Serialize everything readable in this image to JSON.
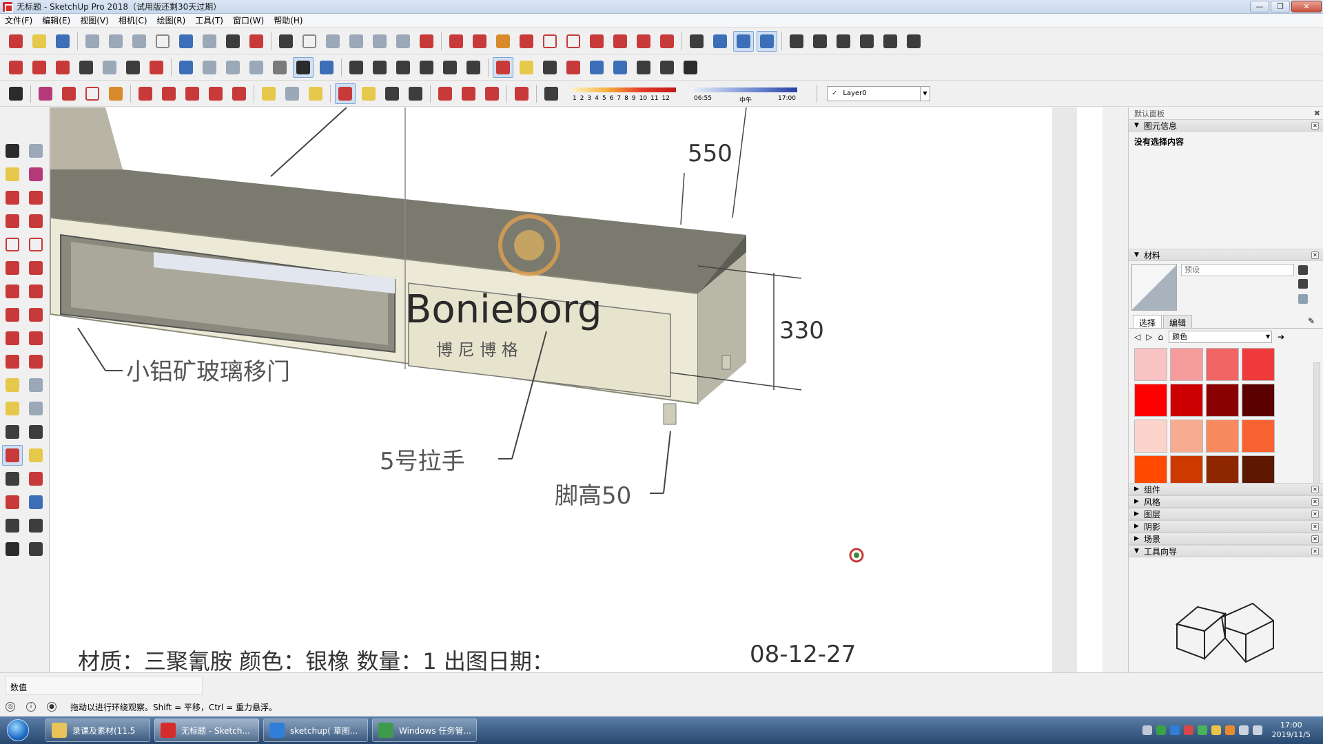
{
  "window": {
    "title": "无标题 - SketchUp Pro 2018（试用版还剩30天过期）",
    "buttons": {
      "minimize": "—",
      "maximize": "❐",
      "close": "✕"
    }
  },
  "menu": [
    "文件(F)",
    "编辑(E)",
    "视图(V)",
    "相机(C)",
    "绘图(R)",
    "工具(T)",
    "窗口(W)",
    "帮助(H)"
  ],
  "toolbar3": {
    "scale_numbers": [
      "1",
      "2",
      "3",
      "4",
      "5",
      "6",
      "7",
      "8",
      "9",
      "10",
      "11",
      "12"
    ],
    "time_start": "06:55",
    "time_mid": "中午",
    "time_end": "17:00",
    "layer": "Layer0"
  },
  "viewport": {
    "dim_550": "550",
    "dim_330": "330",
    "label_door": "小铝矿玻璃移门",
    "label_handle": "5号拉手",
    "label_foot": "脚高50",
    "logo_text": "Bonieborg",
    "logo_sub": "博  尼  博  格",
    "bottom_text": "材质：三聚氰胺 颜色：银橡 数量：1 出图日期：",
    "date": "08-12-27"
  },
  "panel": {
    "title": "默认面板",
    "entity_info": {
      "heading": "图元信息",
      "body": "没有选择内容"
    },
    "materials": {
      "heading": "材料",
      "name_placeholder": "预设",
      "tab_select": "选择",
      "tab_edit": "编辑",
      "library": "颜色",
      "swatches": [
        "#f9c3c3",
        "#f59c9c",
        "#f06464",
        "#ee3a3a",
        "#ff0000",
        "#cc0000",
        "#8b0000",
        "#5a0000",
        "#fcd4cb",
        "#f9ab92",
        "#f78a5e",
        "#f76232",
        "#ff4a00",
        "#cc3a00",
        "#8e2700",
        "#5c1800"
      ]
    },
    "collapsed": [
      "组件",
      "风格",
      "图层",
      "阴影",
      "场景"
    ],
    "instructor": {
      "heading": "工具向导"
    }
  },
  "value_label": "数值",
  "status": "拖动以进行环绕观察。Shift = 平移，Ctrl = 重力悬浮。",
  "taskbar": {
    "tasks": [
      "录课及素材(11.5",
      "无标题 - Sketch...",
      "sketchup( 草图...",
      "Windows 任务管..."
    ],
    "time": "17:00",
    "date": "2019/11/5"
  }
}
